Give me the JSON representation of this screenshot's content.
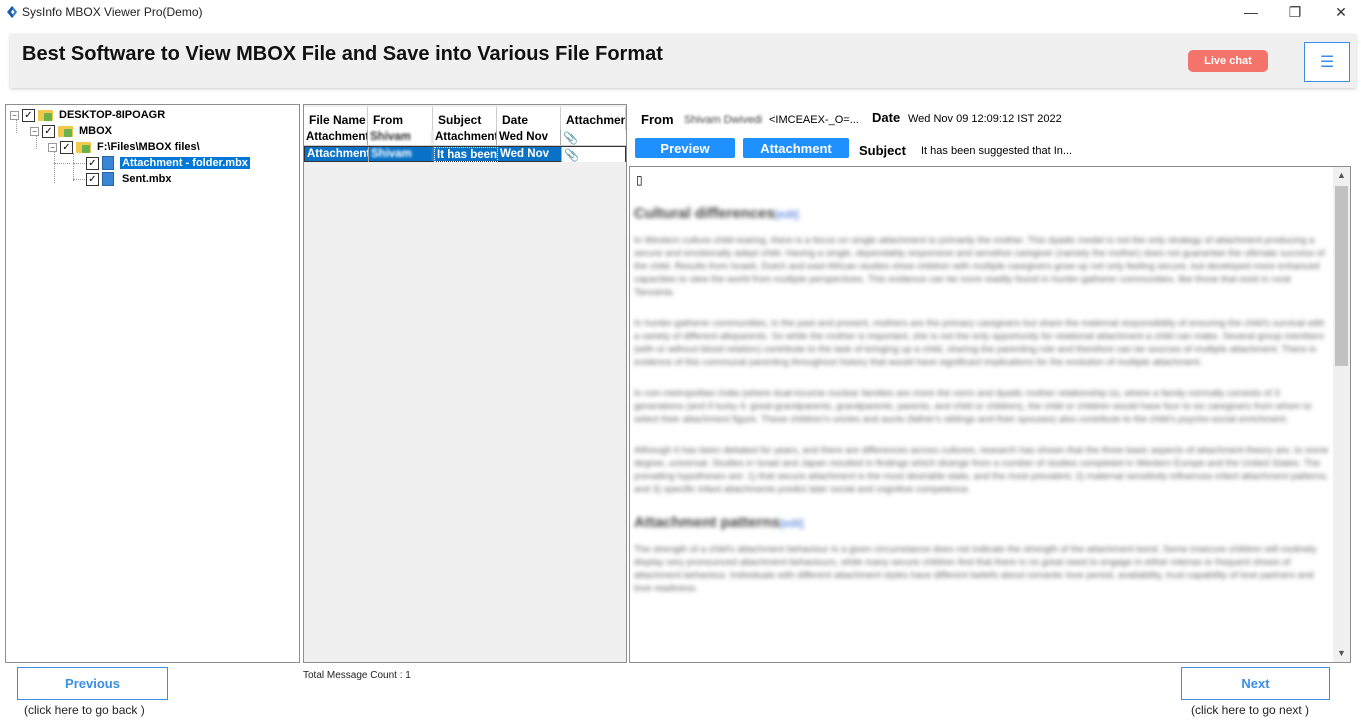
{
  "window": {
    "title": "SysInfo MBOX Viewer Pro(Demo)",
    "minimize_glyph": "—",
    "maximize_glyph": "❐",
    "close_glyph": "✕"
  },
  "banner": {
    "title": "Best Software to View MBOX File and Save into Various File Format",
    "live_chat_label": "Live chat",
    "menu_glyph": "☰"
  },
  "tree": {
    "nodes": [
      {
        "label": "DESKTOP-8IPOAGR",
        "checked": true,
        "icon": "computer-folder-icon"
      },
      {
        "label": "MBOX",
        "checked": true,
        "icon": "folder-icon"
      },
      {
        "label": "F:\\Files\\MBOX files\\",
        "checked": true,
        "icon": "folder-icon"
      },
      {
        "label": "Attachment - folder.mbx",
        "checked": true,
        "icon": "mbox-file-icon",
        "selected": true
      },
      {
        "label": "Sent.mbx",
        "checked": true,
        "icon": "mbox-file-icon"
      }
    ]
  },
  "message_list": {
    "columns": [
      "File Name",
      "From",
      "Subject",
      "Date",
      "Attachment"
    ],
    "rows": [
      {
        "file_name": "Attachment",
        "from": "Shivam",
        "subject": "Attachment",
        "date": "Wed Nov",
        "has_attachment": true,
        "selected": false
      },
      {
        "file_name": "Attachment",
        "from": "Shivam",
        "subject": "It has been",
        "date": "Wed Nov",
        "has_attachment": true,
        "selected": true
      }
    ],
    "total_label": "Total Message Count : 1"
  },
  "message_meta": {
    "from_label": "From",
    "from_name": "Shivam Dwivedi",
    "from_address": "<IMCEAEX-_O=...",
    "date_label": "Date",
    "date_value": "Wed Nov 09 12:09:12 IST 2022",
    "preview_label": "Preview",
    "attachment_label": "Attachment",
    "subject_label": "Subject",
    "subject_value": "It has been suggested that In..."
  },
  "preview": {
    "box_char": "▯",
    "heading_1": "Cultural differences",
    "edit_1": "[edit]",
    "para_1": "In Western culture child-rearing, there is a focus on single attachment to primarily the mother. This dyadic model is not the only strategy of attachment producing a secure and emotionally adept child. Having a single, dependably responsive and sensitive caregiver (namely the mother) does not guarantee the ultimate success of the child. Results from Israeli, Dutch and east African studies show children with multiple caregivers grow up not only feeling secure, but developed more enhanced capacities to view the world from multiple perspectives. This evidence can be more readily found in hunter-gatherer communities, like those that exist in rural Tanzania.",
    "para_2": "In hunter-gatherer communities, in the past and present, mothers are the primary caregivers but share the maternal responsibility of ensuring the child's survival with a variety of different alloparents. So while the mother is important, she is not the only opportunity for relational attachment a child can make. Several group members (with or without blood relation) contribute to the task of bringing up a child, sharing the parenting role and therefore can be sources of multiple attachment. There is evidence of this communal parenting throughout history that would have significant implications for the evolution of multiple attachment.",
    "para_3": "In non-metropolitan India (where dual-income nuclear families are more the norm and dyadic mother relationship is), where a family normally consists of 3 generations (and if lucky 4: great-grandparents, grandparents, parents, and child or children), the child or children would have four to six caregivers from whom to select their attachment figure. These children's uncles and aunts (father's siblings and their spouses) also contribute to the child's psycho-social enrichment.",
    "para_4": "Although it has been debated for years, and there are differences across cultures, research has shown that the three basic aspects of attachment theory are, to some degree, universal. Studies in Israel and Japan resulted in findings which diverge from a number of studies completed in Western Europe and the United States. The prevailing hypotheses are: 1) that secure attachment is the most desirable state, and the most prevalent; 2) maternal sensitivity influences infant attachment patterns; and 3) specific infant attachments predict later social and cognitive competence.",
    "heading_2": "Attachment patterns",
    "edit_2": "[edit]",
    "para_5": "The strength of a child's attachment behaviour in a given circumstance does not indicate the strength of the attachment bond. Some insecure children will routinely display very pronounced attachment behaviours, while many secure children find that there is no great need to engage in either intense or frequent shows of attachment behaviour. Individuals with different attachment styles have different beliefs about romantic love period, availability, trust capability of love partners and love readiness."
  },
  "navigation": {
    "previous_label": "Previous",
    "previous_hint": "(click here to  go back )",
    "next_label": "Next",
    "next_hint": "(click here to  go next )"
  }
}
